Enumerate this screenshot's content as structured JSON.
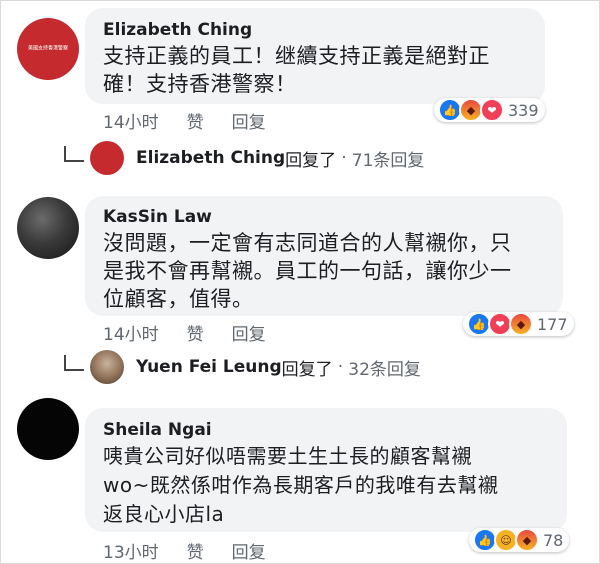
{
  "comments": [
    {
      "name": "Elizabeth Ching",
      "avatar_text": "美國支持香港警察",
      "text_lines": [
        "支持正義的員工！继續支持正義是絕對正",
        "確！支持香港警察！"
      ],
      "time": "14小时",
      "like": "赞",
      "reply": "回复",
      "reactions": [
        "like-icon",
        "angry-icon",
        "love-icon"
      ],
      "reaction_count": "339",
      "reply_summary": {
        "name": "Elizabeth Ching",
        "verb": "回复了",
        "sep": "·",
        "count": "71条回复"
      }
    },
    {
      "name": "KasSin Law",
      "text_lines": [
        "沒問題，一定會有志同道合的人幫襯你，只",
        "是我不會再幫襯。員工的一句話，讓你少一",
        "位顧客，值得。"
      ],
      "time": "14小时",
      "like": "赞",
      "reply": "回复",
      "reactions": [
        "like-icon",
        "love-icon",
        "angry-icon"
      ],
      "reaction_count": "177",
      "reply_summary": {
        "name": "Yuen Fei Leung",
        "verb": "回复了",
        "sep": "·",
        "count": "32条回复"
      }
    },
    {
      "name": "Sheila Ngai",
      "text_lines": [
        "咦貴公司好似唔需要土生土長的顧客幫襯",
        "wo~既然係咁作為長期客戶的我唯有去幫襯",
        "返良心小店la"
      ],
      "time": "13小时",
      "like": "赞",
      "reply": "回复",
      "reactions": [
        "like-icon",
        "haha-icon",
        "angry-icon"
      ],
      "reaction_count": "78"
    }
  ],
  "colors": {
    "bubble": "#f2f3f5",
    "meta": "#60676f",
    "like_blue": "#1877f2",
    "love_red": "#f33e58"
  }
}
